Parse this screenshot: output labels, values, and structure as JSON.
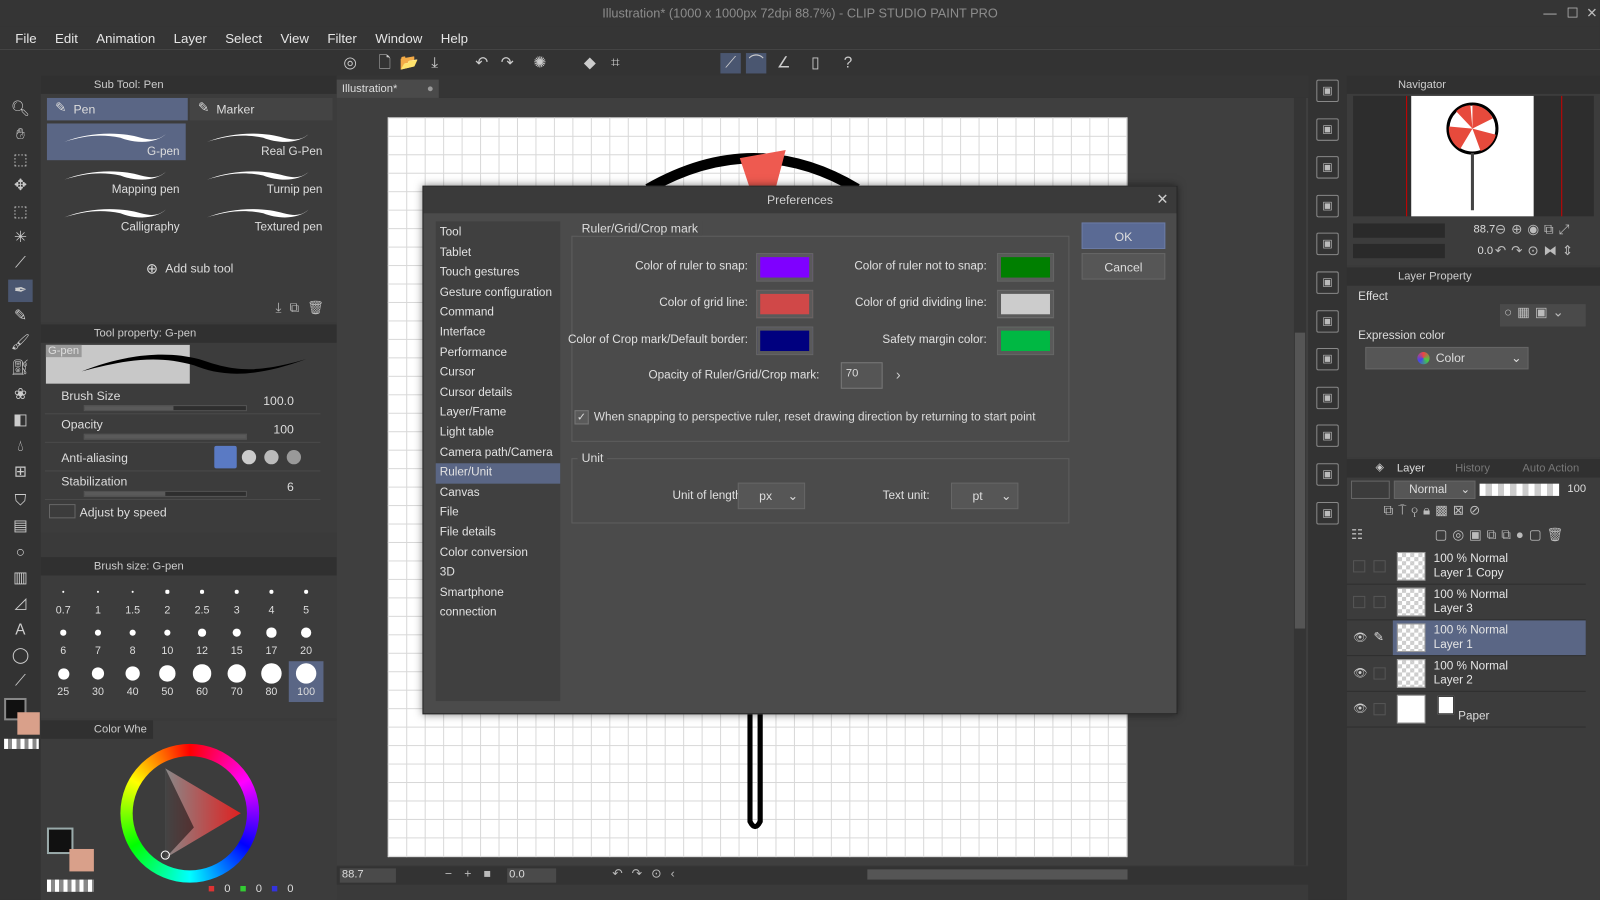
{
  "window": {
    "title": "Illustration* (1000 x 1000px 72dpi 88.7%)  - CLIP STUDIO PAINT PRO"
  },
  "menu": [
    "File",
    "Edit",
    "Animation",
    "Layer",
    "Select",
    "View",
    "Filter",
    "Window",
    "Help"
  ],
  "sub_tool": {
    "header": "Sub Tool: Pen",
    "tabs": [
      "Pen",
      "Marker"
    ],
    "brushes": [
      "G-pen",
      "Real G-Pen",
      "Mapping pen",
      "Turnip pen",
      "Calligraphy",
      "Textured pen"
    ],
    "selected": "G-pen",
    "add_label": "Add sub tool"
  },
  "tool_property": {
    "header": "Tool property: G-pen",
    "preview_label": "G-pen",
    "brush_size": {
      "label": "Brush Size",
      "value": "100.0",
      "fraction": 0.55
    },
    "opacity": {
      "label": "Opacity",
      "value": "100",
      "fraction": 1.0
    },
    "anti_aliasing": {
      "label": "Anti-aliasing"
    },
    "stabilization": {
      "label": "Stabilization",
      "value": "6",
      "fraction": 0.5
    },
    "adjust_by_speed": "Adjust by speed"
  },
  "brush_size_panel": {
    "header": "Brush size: G-pen",
    "sizes": [
      "0.7",
      "1",
      "1.5",
      "2",
      "2.5",
      "3",
      "4",
      "5",
      "6",
      "7",
      "8",
      "10",
      "12",
      "15",
      "17",
      "20",
      "25",
      "30",
      "40",
      "50",
      "60",
      "70",
      "80",
      "100"
    ],
    "selected": "100"
  },
  "color_panel": {
    "header": "Color Whe",
    "rgb": [
      "0",
      "0",
      "0"
    ],
    "main_color": "#111111",
    "sub_color": "#d9a08a"
  },
  "canvas": {
    "tab": "Illustration*",
    "zoom": "88.7",
    "rotation": "0.0"
  },
  "dialog": {
    "title": "Preferences",
    "categories": [
      "Tool",
      "Tablet",
      "Touch gestures",
      "Gesture configuration",
      "Command",
      "Interface",
      "Performance",
      "Cursor",
      "Cursor details",
      "Layer/Frame",
      "Light table",
      "Camera path/Camera",
      "Ruler/Unit",
      "Canvas",
      "File",
      "File details",
      "Color conversion",
      "3D",
      "Smartphone connection"
    ],
    "selected_category": "Ruler/Unit",
    "ruler_group": "Ruler/Grid/Crop mark",
    "colors": [
      {
        "label": "Color of ruler to snap:",
        "color": "#7f00ff"
      },
      {
        "label": "Color of ruler not to snap:",
        "color": "#007f00"
      },
      {
        "label": "Color of grid line:",
        "color": "#d04848"
      },
      {
        "label": "Color of grid dividing line:",
        "color": "#cccccc"
      },
      {
        "label": "Color of Crop mark/Default border:",
        "color": "#00007f"
      },
      {
        "label": "Safety margin color:",
        "color": "#00b843"
      }
    ],
    "opacity_label": "Opacity of Ruler/Grid/Crop mark:",
    "opacity_value": "70",
    "checkbox_label": "When snapping to perspective ruler, reset drawing direction by returning to start point",
    "checkbox_checked": true,
    "unit_group": "Unit",
    "unit_length_label": "Unit of length:",
    "unit_length": "px",
    "text_unit_label": "Text unit:",
    "text_unit": "pt",
    "ok": "OK",
    "cancel": "Cancel"
  },
  "navigator": {
    "tab": "Navigator",
    "zoom": "88.7",
    "angle": "0.0"
  },
  "layer_property": {
    "tab": "Layer Property",
    "effect": "Effect",
    "expression_color_label": "Expression color",
    "expression_color": "Color"
  },
  "layer_panel": {
    "tabs": [
      "Layer",
      "History",
      "Auto Action"
    ],
    "blend_mode": "Normal",
    "opacity": "100",
    "layers": [
      {
        "mode": "100 % Normal",
        "name": "Layer 1 Copy",
        "visible": false,
        "selected": false
      },
      {
        "mode": "100 % Normal",
        "name": "Layer 3",
        "visible": false,
        "selected": false
      },
      {
        "mode": "100 % Normal",
        "name": "Layer 1",
        "visible": true,
        "selected": true
      },
      {
        "mode": "100 % Normal",
        "name": "Layer 2",
        "visible": true,
        "selected": false
      }
    ],
    "paper": "Paper"
  }
}
